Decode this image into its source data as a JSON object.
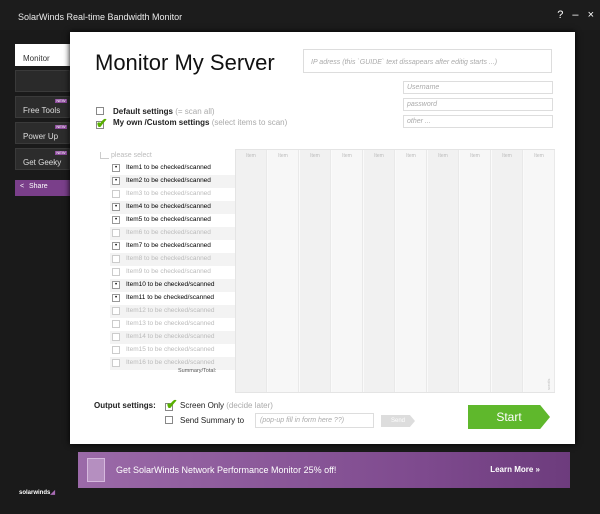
{
  "window": {
    "title": "SolarWinds Real-time Bandwidth Monitor",
    "controls": [
      "?",
      "–",
      "×"
    ]
  },
  "sidebar": {
    "items": [
      {
        "label": "Monitor",
        "active": true,
        "new": false
      },
      {
        "label": "",
        "active": false,
        "new": false
      },
      {
        "label": "Free Tools",
        "active": false,
        "new": true
      },
      {
        "label": "Power Up",
        "active": false,
        "new": true
      },
      {
        "label": "Get Geeky",
        "active": false,
        "new": true
      }
    ],
    "new_tag": "NEW",
    "share_label": "Share",
    "share_icon": "share-icon"
  },
  "main": {
    "title": "Monitor My Server",
    "ip_placeholder": "IP adress (this `GUIDE` text dissapears after editig starts ...)",
    "username_placeholder": "Username",
    "password_placeholder": "password",
    "other_placeholder": "other ...",
    "default_settings": {
      "label": "Default settings",
      "hint": "(= scan all)",
      "checked": false
    },
    "custom_settings": {
      "label": "My own /Custom settings",
      "hint": "(select items to scan)",
      "checked": true
    },
    "please_select": "please select",
    "items": [
      {
        "label": "Item1 to be checked/scanned",
        "checked": true
      },
      {
        "label": "Item2 to be checked/scanned",
        "checked": true
      },
      {
        "label": "Item3 to be checked/scanned",
        "checked": false
      },
      {
        "label": "Item4 to be checked/scanned",
        "checked": true
      },
      {
        "label": "Item5 to be checked/scanned",
        "checked": true
      },
      {
        "label": "Item6 to be checked/scanned",
        "checked": false
      },
      {
        "label": "Item7 to be checked/scanned",
        "checked": true
      },
      {
        "label": "Item8 to be checked/scanned",
        "checked": false
      },
      {
        "label": "Item9 to be checked/scanned",
        "checked": false
      },
      {
        "label": "Item10 to be checked/scanned",
        "checked": true
      },
      {
        "label": "Item11 to be checked/scanned",
        "checked": true
      },
      {
        "label": "Item12 to be checked/scanned",
        "checked": false
      },
      {
        "label": "Item13 to be checked/scanned",
        "checked": false
      },
      {
        "label": "Item14 to be checked/scanned",
        "checked": false
      },
      {
        "label": "Item15 to be checked/scanned",
        "checked": false
      },
      {
        "label": "Item16 to be checked/scanned",
        "checked": false
      }
    ],
    "summary_label": "Summary/Total:",
    "grid_headers": [
      "Item",
      "Item",
      "Item",
      "Item",
      "Item",
      "Item",
      "Item",
      "Item",
      "Item",
      "Item"
    ],
    "grid_side_label": "scrolls"
  },
  "output": {
    "label": "Output settings:",
    "screen_only": {
      "label": "Screen Only",
      "hint": "(decide later)",
      "checked": true
    },
    "send_summary": {
      "label": "Send Summary to",
      "checked": false
    },
    "popup_placeholder": "(pop-up fill in form here ??)",
    "send_button": "Send",
    "start_button": "Start"
  },
  "banner": {
    "text": "Get SolarWinds Network Performance Monitor 25% off!",
    "link": "Learn More »"
  },
  "logo": {
    "text": "solarwinds"
  }
}
